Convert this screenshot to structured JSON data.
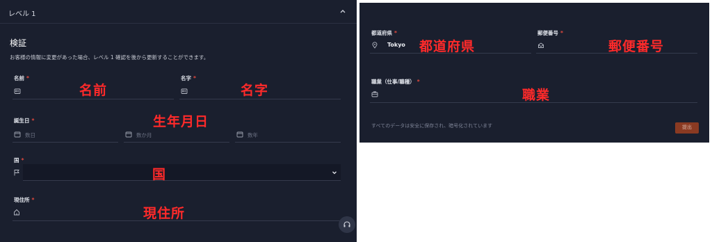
{
  "level": {
    "title": "レベル 1"
  },
  "section": {
    "title": "検証",
    "description": "お客様の情報に変更があった場合、レベル 1 確認を後から更新することができます。"
  },
  "required_mark": "*",
  "fields": {
    "first_name": {
      "label": "名前",
      "annotation": "名前"
    },
    "last_name": {
      "label": "名字",
      "annotation": "名字"
    },
    "birthdate": {
      "label": "誕生日",
      "annotation": "生年月日",
      "day_placeholder": "数日",
      "month_placeholder": "数か月",
      "year_placeholder": "数年"
    },
    "country": {
      "label": "国",
      "annotation": "国"
    },
    "address": {
      "label": "現住所",
      "annotation": "現住所"
    },
    "prefecture": {
      "label": "都道府県",
      "value": "Tokyo",
      "annotation": "都道府県"
    },
    "postal_code": {
      "label": "郵便番号",
      "annotation": "郵便番号"
    },
    "occupation": {
      "label": "職業（仕事/職種）",
      "annotation": "職業"
    }
  },
  "footer": {
    "note": "すべてのデータは安全に保存され、暗号化されています",
    "submit_label": "提出"
  },
  "colors": {
    "panel_bg": "#1a1f2e",
    "required": "#e0493e",
    "annotation": "#ff2a2a",
    "submit_bg": "#8a3a22"
  },
  "icons": [
    "chevron-up-icon",
    "id-card-icon",
    "calendar-icon",
    "flag-icon",
    "chevron-down-icon",
    "home-icon",
    "location-pin-icon",
    "mailbox-icon",
    "briefcase-icon",
    "headset-icon"
  ]
}
